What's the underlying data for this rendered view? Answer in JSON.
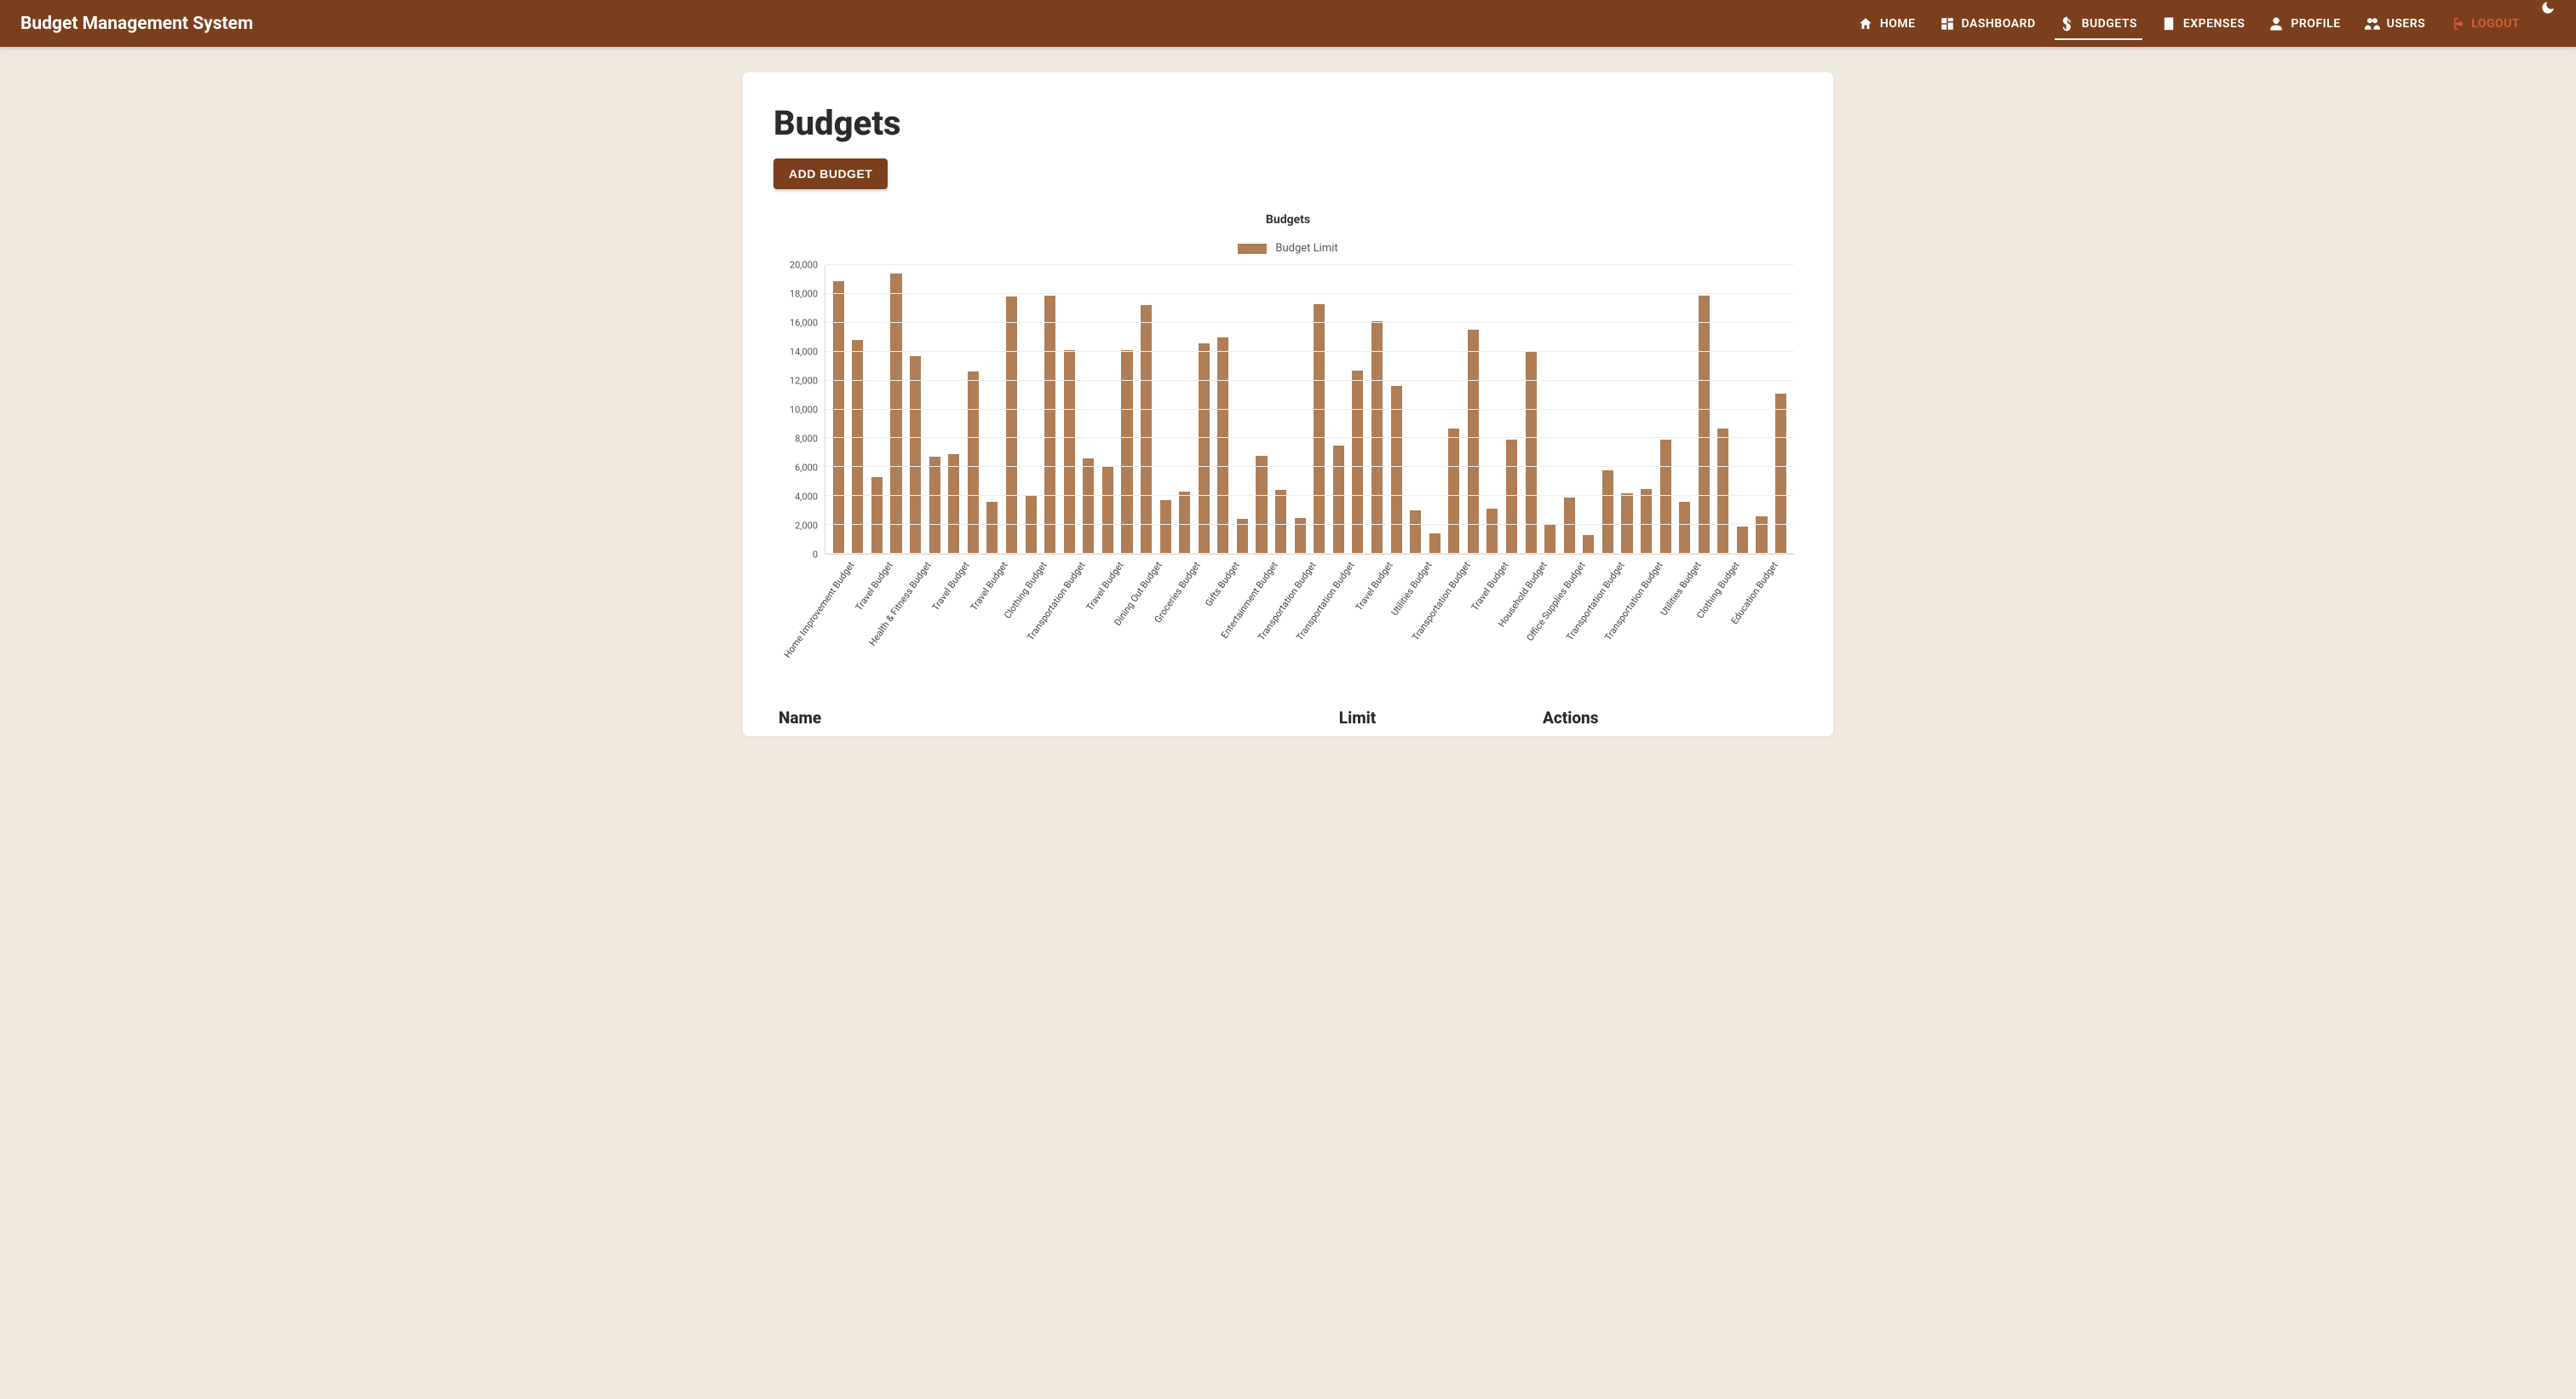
{
  "brand": "Budget Management System",
  "nav": {
    "home": "HOME",
    "dashboard": "DASHBOARD",
    "budgets": "BUDGETS",
    "expenses": "EXPENSES",
    "profile": "PROFILE",
    "users": "USERS",
    "logout": "LOGOUT"
  },
  "page": {
    "title": "Budgets",
    "add_button": "ADD BUDGET"
  },
  "table": {
    "col_name": "Name",
    "col_limit": "Limit",
    "col_actions": "Actions"
  },
  "chart_data": {
    "type": "bar",
    "title": "Budgets",
    "legend": "Budget Limit",
    "xlabel": "",
    "ylabel": "",
    "ylim": [
      0,
      20000
    ],
    "y_ticks": [
      0,
      2000,
      4000,
      6000,
      8000,
      10000,
      12000,
      14000,
      16000,
      18000,
      20000
    ],
    "y_tick_labels": [
      "0",
      "2,000",
      "4,000",
      "6,000",
      "8,000",
      "10,000",
      "12,000",
      "14,000",
      "16,000",
      "18,000",
      "20,000"
    ],
    "categories": [
      "Home Improvement Budget",
      "Travel Budget",
      "Health & Fitness Budget",
      "Travel Budget",
      "Travel Budget",
      "Clothing Budget",
      "Transportation Budget",
      "Travel Budget",
      "Dining Out Budget",
      "Groceries Budget",
      "Gifts Budget",
      "Entertainment Budget",
      "Transportation Budget",
      "Transportation Budget",
      "Travel Budget",
      "Utilities Budget",
      "Transportation Budget",
      "Travel Budget",
      "Household Budget",
      "Office Supplies Budget",
      "Transportation Budget",
      "Transportation Budget",
      "Utilities Budget",
      "Clothing Budget",
      "Education Budget"
    ],
    "series": [
      {
        "name": "Budget Limit",
        "values": [
          [
            18900,
            14800
          ],
          [
            5300,
            19400
          ],
          [
            13700,
            6700
          ],
          [
            6900,
            12600
          ],
          [
            3600,
            17800
          ],
          [
            4100,
            17900
          ],
          [
            14100,
            6600
          ],
          [
            6100,
            14100
          ],
          [
            17200,
            3700
          ],
          [
            4300,
            14600
          ],
          [
            15000,
            2400
          ],
          [
            6800,
            4400
          ],
          [
            2500,
            17300
          ],
          [
            7500,
            12700
          ],
          [
            16100,
            11600
          ],
          [
            3000,
            1400
          ],
          [
            8700,
            15500
          ],
          [
            3100,
            7900
          ],
          [
            14000,
            2000
          ],
          [
            3900,
            1300
          ],
          [
            5800,
            4200
          ],
          [
            4500,
            7900
          ],
          [
            3600,
            17900
          ],
          [
            8700,
            1900
          ],
          [
            2600,
            11100
          ]
        ]
      }
    ]
  }
}
